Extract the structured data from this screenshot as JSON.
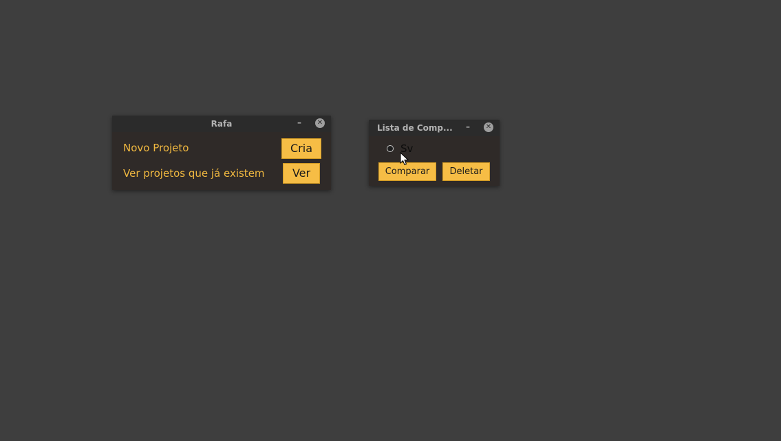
{
  "windows": {
    "rafa": {
      "title": "Rafa",
      "minimize": "–",
      "close": "✕",
      "rows": [
        {
          "label": "Novo Projeto",
          "button": "Cria"
        },
        {
          "label": "Ver projetos que já existem",
          "button": "Ver"
        }
      ]
    },
    "lista": {
      "title": "Lista de Comp...",
      "minimize": "–",
      "close": "✕",
      "radio_option": "Sv",
      "radio_selected": false,
      "buttons": {
        "compare": "Comparar",
        "delete": "Deletar"
      }
    }
  },
  "colors": {
    "desktop_bg": "#3e3e3e",
    "window_bg": "#2f2a28",
    "accent_yellow": "#f6bd45",
    "label_yellow": "#f0b840"
  },
  "icons": {
    "minimize": "minimize-icon",
    "close": "close-icon",
    "cursor": "mouse-pointer-icon"
  }
}
